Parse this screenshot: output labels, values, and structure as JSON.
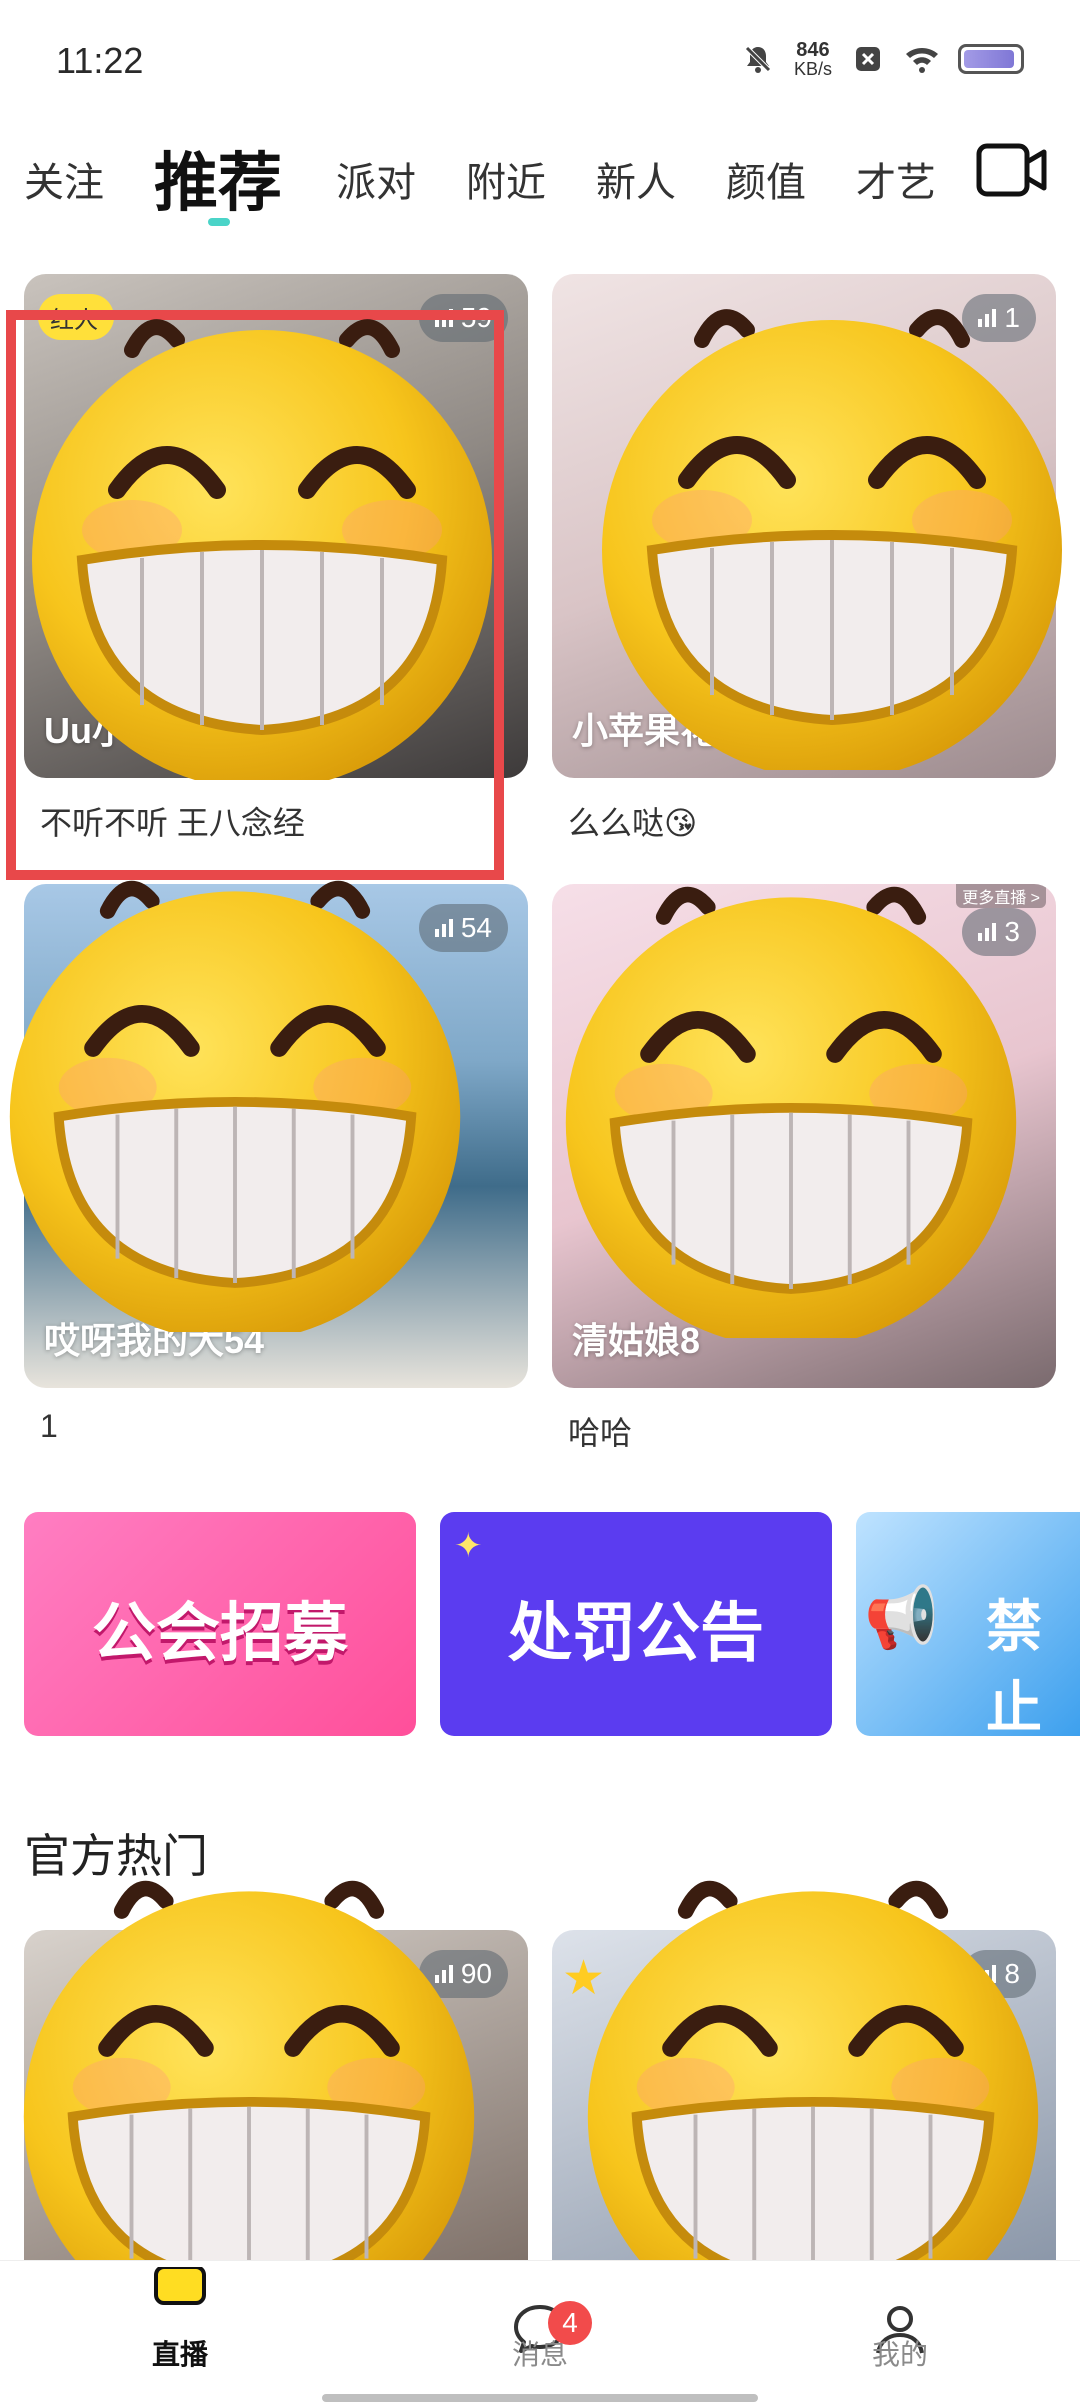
{
  "status_bar": {
    "time": "11:22",
    "net_speed_value": "846",
    "net_speed_unit": "KB/s"
  },
  "top_tabs": [
    {
      "label": "关注"
    },
    {
      "label": "推荐"
    },
    {
      "label": "派对"
    },
    {
      "label": "附近"
    },
    {
      "label": "新人"
    },
    {
      "label": "颜值"
    },
    {
      "label": "才艺"
    }
  ],
  "rooms": [
    {
      "name": "Uu小",
      "subtitle": "不听不听 王八念经",
      "viewers": "59",
      "tag": "红人"
    },
    {
      "name": "小苹果花",
      "subtitle": "么么哒😘",
      "viewers": "1"
    },
    {
      "name": "哎呀我的大54",
      "subtitle": "1",
      "viewers": "54"
    },
    {
      "name": "清姑娘8",
      "subtitle": "哈哈",
      "viewers": "3",
      "corner_text": "更多直播 >"
    }
  ],
  "banners": [
    {
      "text": "公会招募",
      "color": "#ff5fa8"
    },
    {
      "text": "处罚公告",
      "color": "#5b3cf0"
    },
    {
      "text": "禁止",
      "color": "#3da0ee"
    }
  ],
  "section": {
    "title": "官方热门"
  },
  "hot_rooms": [
    {
      "viewers": "90"
    },
    {
      "viewers": "8"
    }
  ],
  "bottom_nav": [
    {
      "label": "直播"
    },
    {
      "label": "消息",
      "badge": "4"
    },
    {
      "label": "我的"
    }
  ]
}
